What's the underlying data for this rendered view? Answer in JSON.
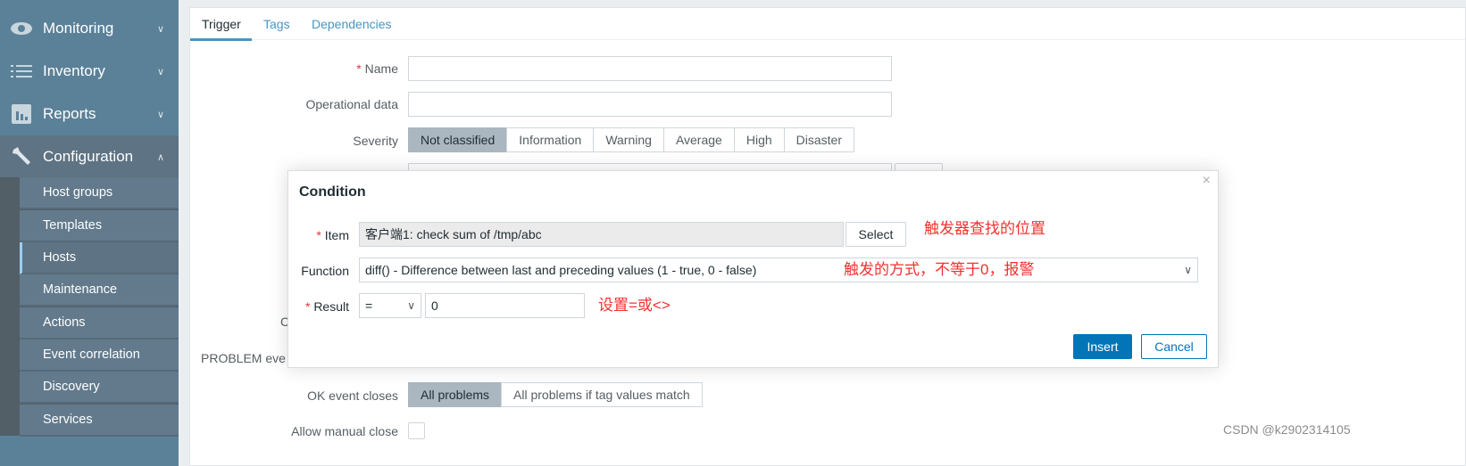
{
  "sidebar": {
    "menus": [
      {
        "label": "Monitoring",
        "icon": "eye-icon"
      },
      {
        "label": "Inventory",
        "icon": "list-icon"
      },
      {
        "label": "Reports",
        "icon": "bar-chart-icon"
      },
      {
        "label": "Configuration",
        "icon": "wrench-icon"
      }
    ],
    "sub_items": [
      "Host groups",
      "Templates",
      "Hosts",
      "Maintenance",
      "Actions",
      "Event correlation",
      "Discovery",
      "Services"
    ],
    "active_sub": "Hosts"
  },
  "tabs": [
    "Trigger",
    "Tags",
    "Dependencies"
  ],
  "form": {
    "name_label": "Name",
    "operational_label": "Operational data",
    "severity_label": "Severity",
    "severities": [
      "Not classified",
      "Information",
      "Warning",
      "Average",
      "High",
      "Disaster"
    ],
    "selected_severity": "Not classified",
    "hidden_label_c": "C",
    "problem_label": "PROBLEM eve",
    "ok_label": "OK event closes",
    "ok_options": [
      "All problems",
      "All problems if tag values match"
    ],
    "manual_label": "Allow manual close"
  },
  "modal": {
    "title": "Condition",
    "item_label": "Item",
    "item_value": "客户端1: check sum of /tmp/abc",
    "select_label": "Select",
    "function_label": "Function",
    "function_value": "diff() - Difference between last and preceding values (1 - true, 0 - false)",
    "result_label": "Result",
    "result_op": "=",
    "result_value": "0",
    "insert_label": "Insert",
    "cancel_label": "Cancel",
    "close": "×"
  },
  "annotations": [
    "触发器查找的位置",
    "触发的方式，不等于0，报警",
    "设置=或<>"
  ],
  "watermark": "CSDN @k2902314105",
  "colors": {
    "accent": "#0275b8",
    "sidebar": "#5b8199",
    "annotation": "#f53030"
  }
}
